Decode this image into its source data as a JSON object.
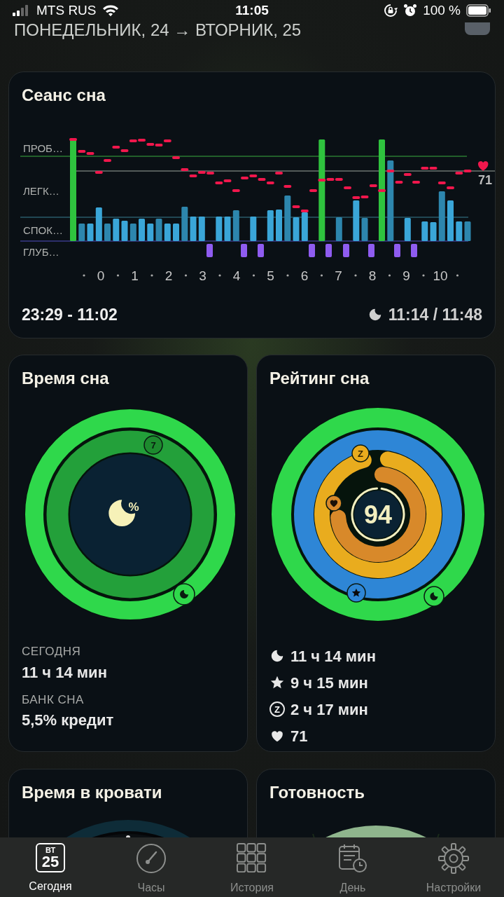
{
  "status_bar": {
    "carrier": "MTS RUS",
    "time": "11:05",
    "battery": "100 %"
  },
  "header": {
    "date_range": "ПОНЕДЕЛЬНИК, 24 → ВТОРНИК, 25"
  },
  "sleep_session": {
    "title": "Сеанс сна",
    "stage_labels": [
      "ПРОБ…",
      "ЛЕГК…",
      "СПОК…",
      "ГЛУБ…"
    ],
    "hour_labels": [
      "0",
      "1",
      "2",
      "3",
      "4",
      "5",
      "6",
      "7",
      "8",
      "9",
      "10"
    ],
    "heart_rate": "71",
    "time_range": "23:29 - 11:02",
    "duration": "11:14 / 11:48"
  },
  "sleep_time": {
    "title": "Время сна",
    "badge": "7",
    "center_symbol": "%",
    "stats": [
      {
        "label": "СЕГОДНЯ",
        "value": "11 ч 14 мин"
      },
      {
        "label": "БАНК СНА",
        "value": "5,5% кредит"
      }
    ]
  },
  "sleep_rating": {
    "title": "Рейтинг сна",
    "score": "94",
    "badge": "Z",
    "stats": [
      {
        "kind": "moon",
        "value": "11 ч 14 мин"
      },
      {
        "kind": "star",
        "value": "9 ч 15 мин"
      },
      {
        "kind": "snooze",
        "symbol": "Z",
        "value": "2 ч 17 мин"
      },
      {
        "kind": "heart",
        "value": "71"
      }
    ]
  },
  "cards": [
    {
      "kind": "dial",
      "title": "Время в кровати"
    },
    {
      "kind": "gauge",
      "title": "Готовность"
    }
  ],
  "tab_bar": [
    {
      "kind": "calendar",
      "label": "Сегодня",
      "selected": true,
      "weekday": "ВТ",
      "date": "25"
    },
    {
      "kind": "clock",
      "label": "Часы",
      "selected": false
    },
    {
      "kind": "grid",
      "label": "История",
      "selected": false
    },
    {
      "kind": "planner",
      "label": "День",
      "selected": false
    },
    {
      "kind": "gear",
      "label": "Настройки",
      "selected": false
    }
  ]
}
